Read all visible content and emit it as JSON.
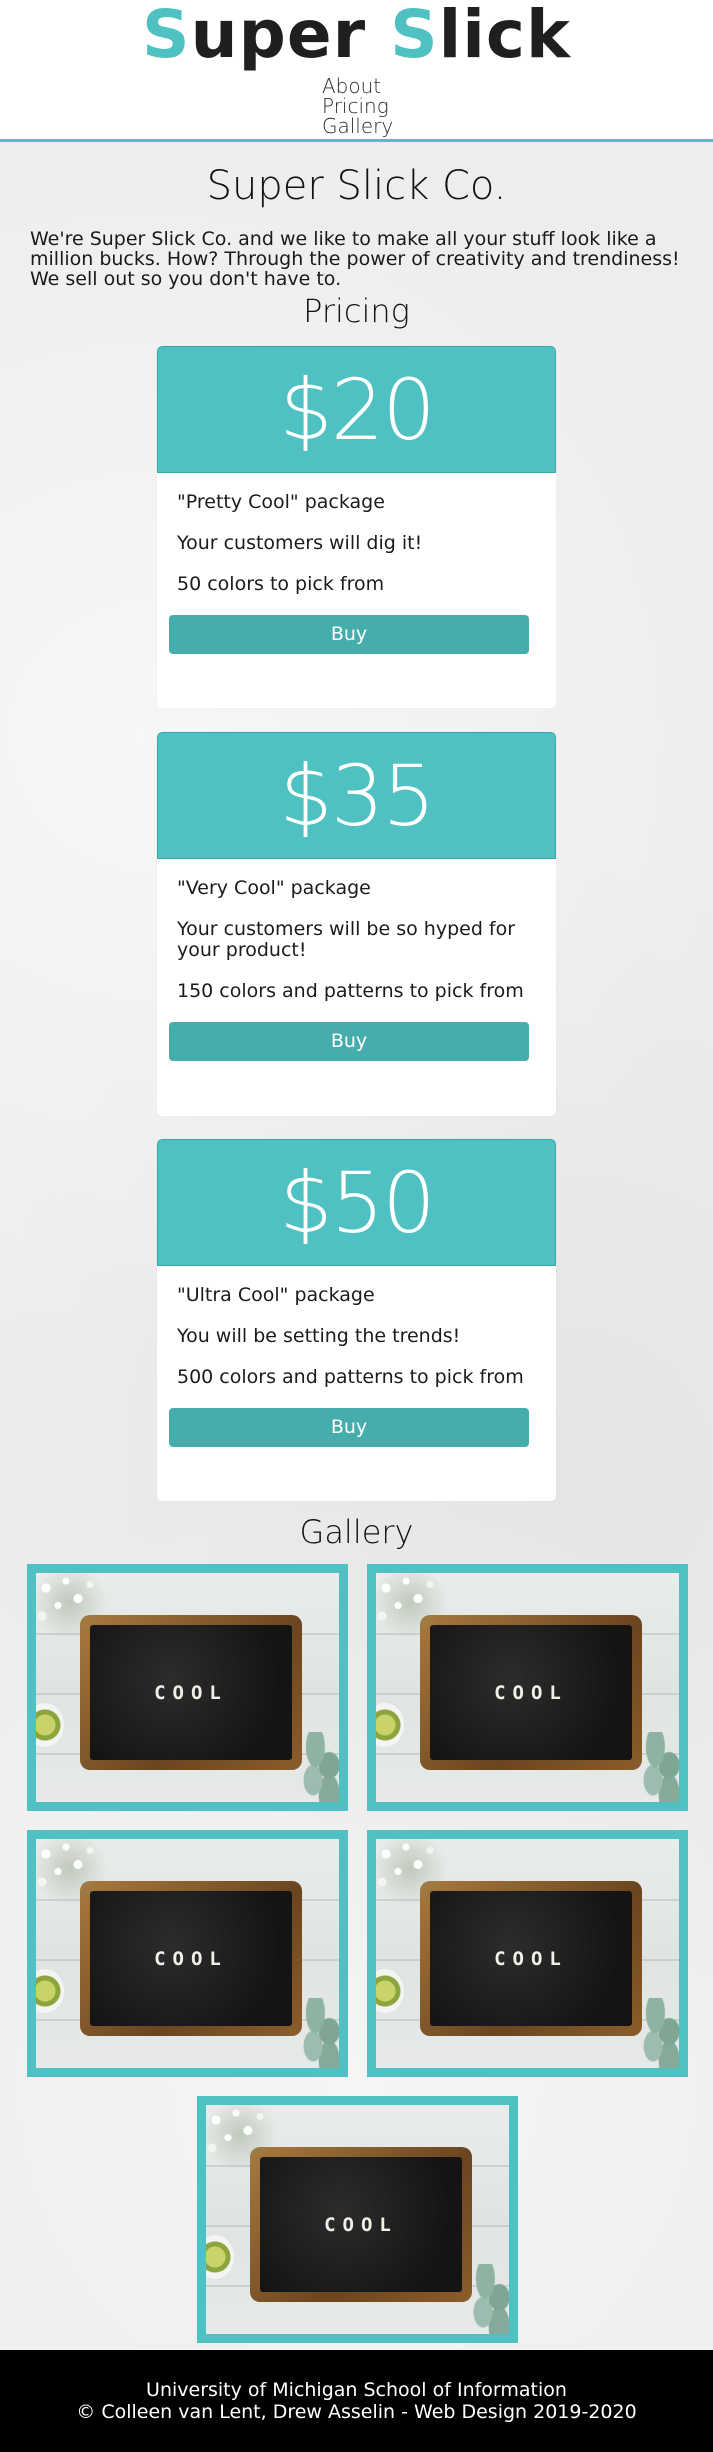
{
  "header": {
    "logo": {
      "first_initial": "S",
      "first_rest": "uper ",
      "second_initial": "S",
      "second_rest": "lick"
    },
    "nav": [
      "About",
      "Pricing",
      "Gallery"
    ]
  },
  "main": {
    "title": "Super Slick Co.",
    "intro": "We're Super Slick Co. and we like to make all your stuff look like a million bucks. How? Through the power of creativity and trendiness! We sell out so you don't have to."
  },
  "pricing": {
    "heading": "Pricing",
    "cards": [
      {
        "price": "$20",
        "features": [
          "\"Pretty Cool\" package",
          "Your customers will dig it!",
          "50 colors to pick from"
        ],
        "button": "Buy"
      },
      {
        "price": "$35",
        "features": [
          "\"Very Cool\" package",
          "Your customers will be so hyped for your product!",
          "150 colors and patterns to pick from"
        ],
        "button": "Buy"
      },
      {
        "price": "$50",
        "features": [
          "\"Ultra Cool\" package",
          "You will be setting the trends!",
          "500 colors and patterns to pick from"
        ],
        "button": "Buy"
      }
    ]
  },
  "gallery": {
    "heading": "Gallery",
    "images": [
      {
        "word": "COOL"
      },
      {
        "word": "COOL"
      },
      {
        "word": "COOL"
      },
      {
        "word": "COOL"
      },
      {
        "word": "COOL"
      }
    ]
  },
  "footer": {
    "line1": "University of Michigan School of Information",
    "line2": "© Colleen van Lent, Drew Asselin - Web Design 2019-2020"
  },
  "colors": {
    "accent": "#4fc1c2",
    "button": "#46adad",
    "footer_bg": "#000000"
  }
}
